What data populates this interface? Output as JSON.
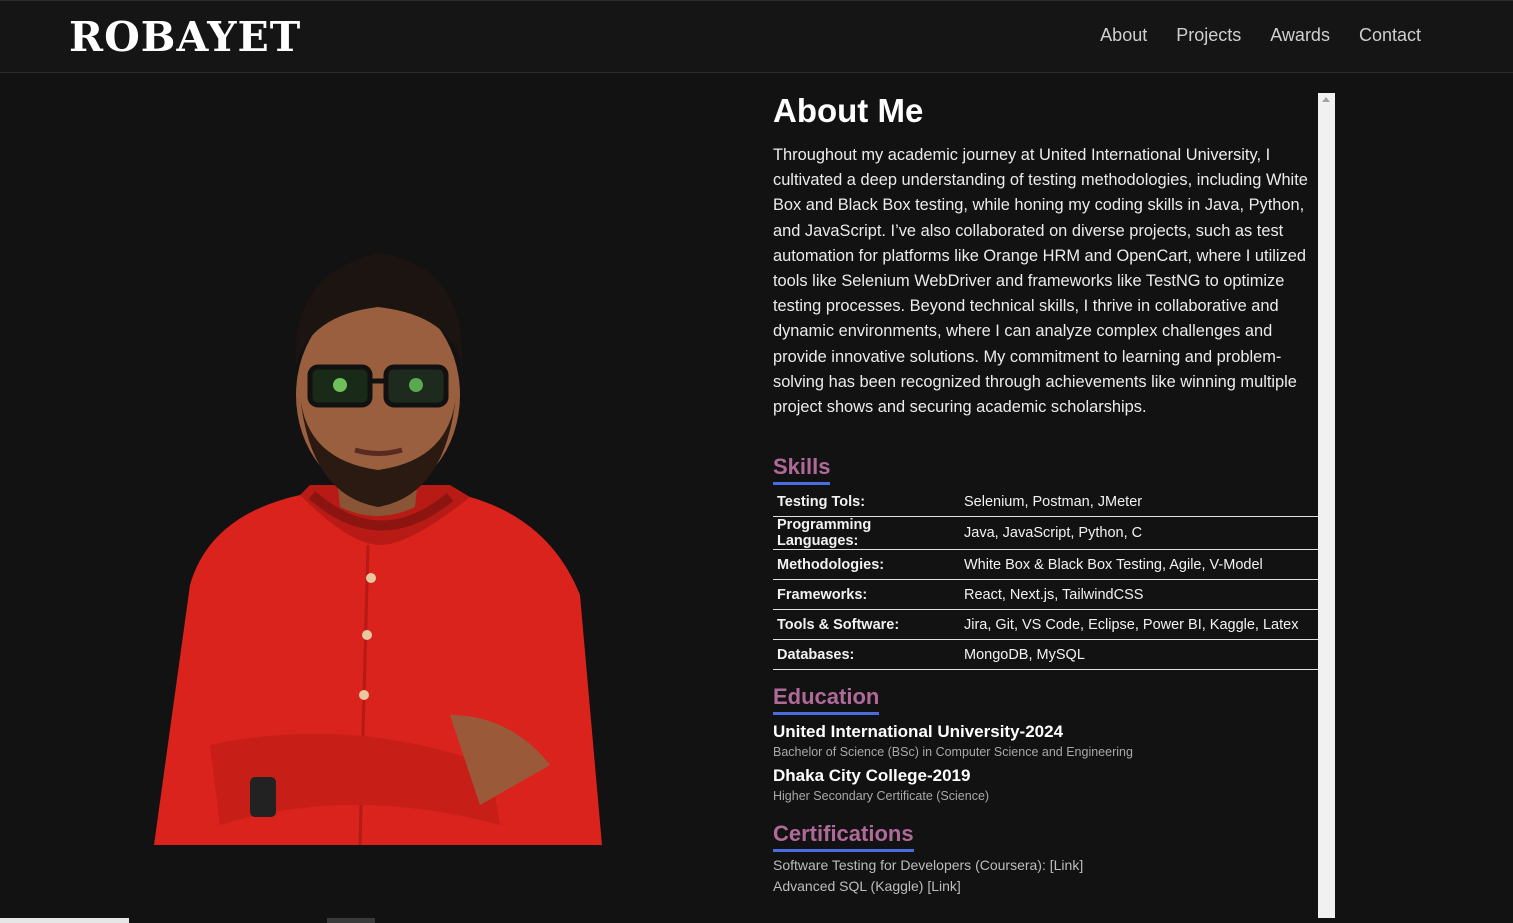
{
  "header": {
    "logo": "ROBAYET",
    "nav": [
      "About",
      "Projects",
      "Awards",
      "Contact"
    ]
  },
  "about": {
    "title": "About Me",
    "text": "Throughout my academic journey at United International University, I cultivated a deep understanding of testing methodologies, including White Box and Black Box testing, while honing my coding skills in Java, Python, and JavaScript. I’ve also collaborated on diverse projects, such as test automation for platforms like Orange HRM and OpenCart, where I utilized tools like Selenium WebDriver and frameworks like TestNG to optimize testing processes. Beyond technical skills, I thrive in collaborative and dynamic environments, where I can analyze complex challenges and provide innovative solutions. My commitment to learning and problem-solving has been recognized through achievements like winning multiple project shows and securing academic scholarships."
  },
  "skills": {
    "heading": "Skills",
    "rows": [
      {
        "label": "Testing Tols:",
        "value": "Selenium, Postman, JMeter"
      },
      {
        "label": "Programming Languages:",
        "value": "Java, JavaScript, Python, C"
      },
      {
        "label": "Methodologies:",
        "value": "White Box & Black Box Testing, Agile, V-Model"
      },
      {
        "label": "Frameworks:",
        "value": "React, Next.js, TailwindCSS"
      },
      {
        "label": "Tools & Software:",
        "value": "Jira, Git, VS Code, Eclipse, Power BI, Kaggle, Latex"
      },
      {
        "label": "Databases:",
        "value": "MongoDB, MySQL"
      }
    ]
  },
  "education": {
    "heading": "Education",
    "items": [
      {
        "school": "United International University-2024",
        "degree": "Bachelor of Science (BSc) in Computer Science and Engineering"
      },
      {
        "school": "Dhaka City College-2019",
        "degree": "Higher Secondary Certificate (Science)"
      }
    ]
  },
  "certifications": {
    "heading": "Certifications",
    "items": [
      {
        "text": "Software Testing for Developers (Coursera): ",
        "link": "[Link]"
      },
      {
        "text": "Advanced SQL (Kaggle) ",
        "link": "[Link]"
      }
    ]
  },
  "colors": {
    "background": "#121212",
    "heading_gradient_start": "#c0648f",
    "heading_gradient_end": "#4b6be0",
    "shirt": "#d9231c"
  },
  "icons": [
    "profile-photo"
  ]
}
